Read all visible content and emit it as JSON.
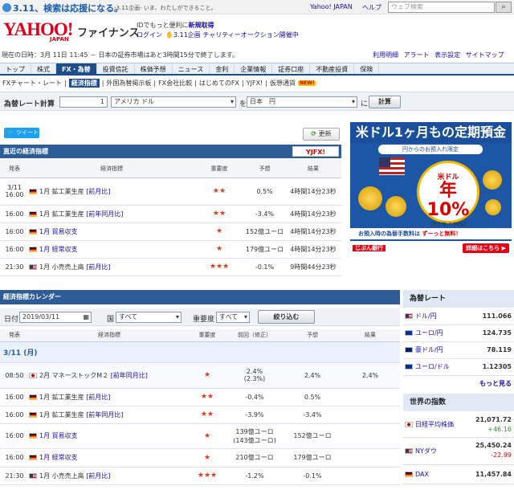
{
  "topbar": {
    "campaign": "3.11、検索は応援になる。",
    "campaign_sub": "-3.11企画- いま、わたしができること。",
    "yahoo_japan": "Yahoo! JAPAN",
    "help": "ヘルプ",
    "search_placeholder": "ウェブ検索"
  },
  "header": {
    "logo": "YAHOO!",
    "logo_sub": "JAPAN",
    "finance": "ファイナンス",
    "id_text": "IDでもっと便利に",
    "register": "新規取得",
    "login": "ログイン",
    "charity": "3.11企画 チャリティーオークション開催中",
    "time_notice": "現在の日時：3月 11日 11:45 － 日本の証券市場はあと3時間15分で終了します。",
    "util_links": [
      "利用明細",
      "アラート",
      "表示設定",
      "サイトマップ"
    ]
  },
  "mainnav": [
    "トップ",
    "株式",
    "FX・為替",
    "投資信託",
    "株価予想",
    "ニュース",
    "金利",
    "企業情報",
    "証券口座",
    "不動産投資",
    "保険"
  ],
  "mainnav_active": "FX・為替",
  "subnav": {
    "items": [
      "FXチャート・レート",
      "経済指標",
      "外国為替掲示板",
      "FX会社比較",
      "はじめてのFX",
      "YJFX!",
      "仮想通貨"
    ],
    "active": "経済指標",
    "new_badge": "NEW!"
  },
  "calc": {
    "label": "為替レート計算",
    "amount": "1",
    "from": "アメリカ ドル",
    "to_label": "を",
    "to": "日本　円",
    "suffix": "に",
    "button": "計算"
  },
  "tweet": "ツイート",
  "refresh": "更新",
  "recent": {
    "title": "直近の経済指標",
    "yufx_badge": "YJFX!",
    "headers": [
      "発表",
      "経済指標",
      "重要度",
      "予想",
      "結果"
    ],
    "rows": [
      {
        "time": "3/11\n16:00",
        "country": "de",
        "name": "1月 鉱工業生産",
        "bracket": "[前月比]",
        "stars": "★★",
        "forecast": "0.5%",
        "result": "4時間14分23秒"
      },
      {
        "time": "16:00",
        "country": "de",
        "name": "1月 鉱工業生産",
        "bracket": "[前年同月比]",
        "stars": "★★",
        "forecast": "-3.4%",
        "result": "4時間14分23秒"
      },
      {
        "time": "16:00",
        "country": "de",
        "name": "1月 貿易収支",
        "bracket": "",
        "stars": "★",
        "forecast": "152億ユーロ",
        "result": "4時間14分23秒"
      },
      {
        "time": "16:00",
        "country": "de",
        "name": "1月 経常収支",
        "bracket": "",
        "stars": "★",
        "forecast": "179億ユーロ",
        "result": "4時間14分23秒"
      },
      {
        "time": "21:30",
        "country": "us",
        "name": "1月 小売売上高",
        "bracket": "[前月比]",
        "stars": "★★★",
        "forecast": "-0.1%",
        "result": "9時間44分23秒"
      }
    ]
  },
  "ad": {
    "headline": "米ドル1ヶ月もの定期預金",
    "sub": "円からのお預入れ限定",
    "currency": "米ドル",
    "rate": "年10%",
    "note": "(税引後 7.96%)",
    "strip_left": "お預入時の為替手数料は",
    "strip_right": "ずーっと無料！",
    "bank": "じぶん銀行",
    "detail": "詳細はこちら ▶"
  },
  "calendar": {
    "title": "経済指標カレンダー",
    "date_label": "日付",
    "date_value": "2019/03/11",
    "country_label": "国",
    "country_value": "すべて",
    "importance_label": "重要度",
    "importance_value": "すべて",
    "filter_button": "絞り込む",
    "headers": [
      "発表",
      "経済指標",
      "重要度",
      "前回（修正）",
      "予想",
      "結果"
    ],
    "date_header": "3/11 (月)",
    "rows": [
      {
        "time": "08:50",
        "country": "jp",
        "name": "2月 マネーストックM２",
        "bracket": "[前年同月比]",
        "stars": "★",
        "prev": "2.4%\n(2.3%)",
        "forecast": "2.4%",
        "result": "2.4%"
      },
      {
        "time": "16:00",
        "country": "de",
        "name": "1月 鉱工業生産",
        "bracket": "[前月比]",
        "stars": "★★",
        "prev": "-0.4%",
        "forecast": "0.5%",
        "result": ""
      },
      {
        "time": "16:00",
        "country": "de",
        "name": "1月 鉱工業生産",
        "bracket": "[前年同月比]",
        "stars": "★★",
        "prev": "-3.9%",
        "forecast": "-3.4%",
        "result": ""
      },
      {
        "time": "16:00",
        "country": "de",
        "name": "1月 貿易収支",
        "bracket": "",
        "stars": "★",
        "prev": "139億ユーロ\n(143億ユーロ)",
        "forecast": "152億ユーロ",
        "result": ""
      },
      {
        "time": "16:00",
        "country": "de",
        "name": "1月 経常収支",
        "bracket": "",
        "stars": "★",
        "prev": "210億ユーロ",
        "forecast": "179億ユーロ",
        "result": ""
      },
      {
        "time": "21:30",
        "country": "us",
        "name": "1月 小売売上高",
        "bracket": "[前月比]",
        "stars": "★★★",
        "prev": "-1.2%",
        "forecast": "-0.1%",
        "result": ""
      }
    ]
  },
  "fx": {
    "title": "為替レート",
    "rows": [
      {
        "flag": "us",
        "name": "ドル/円",
        "value": "111.066"
      },
      {
        "flag": "eu",
        "name": "ユーロ/円",
        "value": "124.735"
      },
      {
        "flag": "au",
        "name": "豪ドル/円",
        "value": "78.119"
      },
      {
        "flag": "eu",
        "name": "ユーロ/ドル",
        "value": "1.12305"
      }
    ],
    "more": "もっと見る"
  },
  "indices": {
    "title": "世界の指数",
    "rows": [
      {
        "flag": "jp",
        "name": "日経平均株価",
        "value": "21,071.72",
        "change": "+46.16"
      },
      {
        "flag": "us",
        "name": "NYダウ",
        "value": "25,450.24",
        "change": "-22.99"
      },
      {
        "flag": "de",
        "name": "DAX",
        "value": "11,457.84",
        "change": ""
      }
    ]
  }
}
